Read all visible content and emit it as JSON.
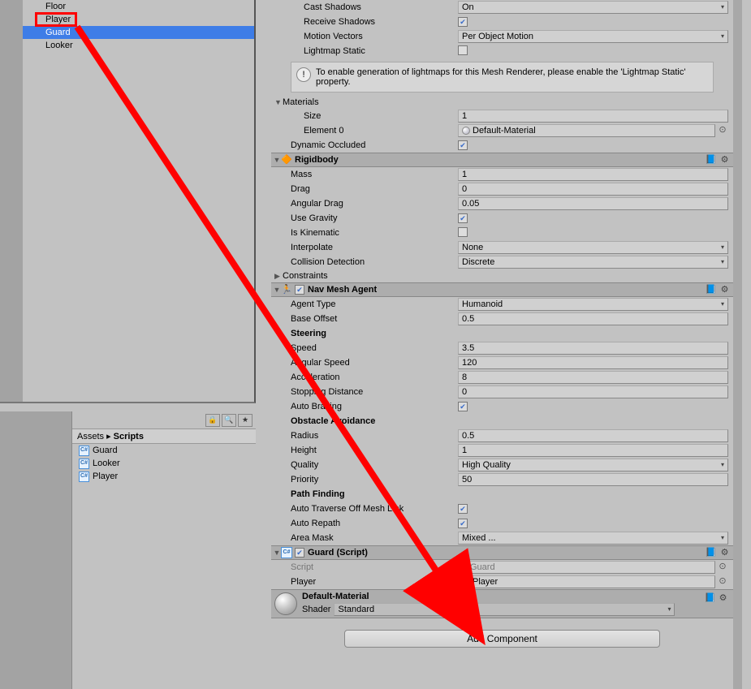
{
  "hierarchy": {
    "items": [
      {
        "label": "Floor"
      },
      {
        "label": "Player"
      },
      {
        "label": "Guard"
      },
      {
        "label": "Looker"
      }
    ],
    "selected_index": 2
  },
  "project": {
    "breadcrumb_root": "Assets",
    "breadcrumb_sep": "▸",
    "breadcrumb_current": "Scripts",
    "items": [
      {
        "label": "Guard",
        "icon": "C#"
      },
      {
        "label": "Looker",
        "icon": "C#"
      },
      {
        "label": "Player",
        "icon": "C#"
      }
    ],
    "toolbar_icons": {
      "search": "🔍",
      "favorite": "★",
      "lock": "🔒"
    }
  },
  "inspector": {
    "meshrenderer": {
      "cast_shadows_label": "Cast Shadows",
      "cast_shadows_value": "On",
      "receive_shadows_label": "Receive Shadows",
      "motion_vectors_label": "Motion Vectors",
      "motion_vectors_value": "Per Object Motion",
      "lightmap_static_label": "Lightmap Static",
      "info_text": "To enable generation of lightmaps for this Mesh Renderer, please enable the 'Lightmap Static' property.",
      "materials_label": "Materials",
      "size_label": "Size",
      "size_value": "1",
      "element0_label": "Element 0",
      "element0_value": "Default-Material",
      "dynamic_occluded_label": "Dynamic Occluded"
    },
    "rigidbody": {
      "title": "Rigidbody",
      "mass_label": "Mass",
      "mass_value": "1",
      "drag_label": "Drag",
      "drag_value": "0",
      "angular_drag_label": "Angular Drag",
      "angular_drag_value": "0.05",
      "use_gravity_label": "Use Gravity",
      "is_kinematic_label": "Is Kinematic",
      "interpolate_label": "Interpolate",
      "interpolate_value": "None",
      "collision_detection_label": "Collision Detection",
      "collision_detection_value": "Discrete",
      "constraints_label": "Constraints"
    },
    "navmesh": {
      "title": "Nav Mesh Agent",
      "agent_type_label": "Agent Type",
      "agent_type_value": "Humanoid",
      "base_offset_label": "Base Offset",
      "base_offset_value": "0.5",
      "steering_label": "Steering",
      "speed_label": "Speed",
      "speed_value": "3.5",
      "angular_speed_label": "Angular Speed",
      "angular_speed_value": "120",
      "acceleration_label": "Acceleration",
      "acceleration_value": "8",
      "stopping_distance_label": "Stopping Distance",
      "stopping_distance_value": "0",
      "auto_braking_label": "Auto Braking",
      "obstacle_avoidance_label": "Obstacle Avoidance",
      "radius_label": "Radius",
      "radius_value": "0.5",
      "height_label": "Height",
      "height_value": "1",
      "quality_label": "Quality",
      "quality_value": "High Quality",
      "priority_label": "Priority",
      "priority_value": "50",
      "path_finding_label": "Path Finding",
      "auto_traverse_label": "Auto Traverse Off Mesh Link",
      "auto_repath_label": "Auto Repath",
      "area_mask_label": "Area Mask",
      "area_mask_value": "Mixed ..."
    },
    "guardscript": {
      "title": "Guard (Script)",
      "script_label": "Script",
      "script_value": "Guard",
      "player_label": "Player",
      "player_value": "Player"
    },
    "material": {
      "name": "Default-Material",
      "shader_label": "Shader",
      "shader_value": "Standard"
    },
    "add_component_label": "Add Component"
  }
}
